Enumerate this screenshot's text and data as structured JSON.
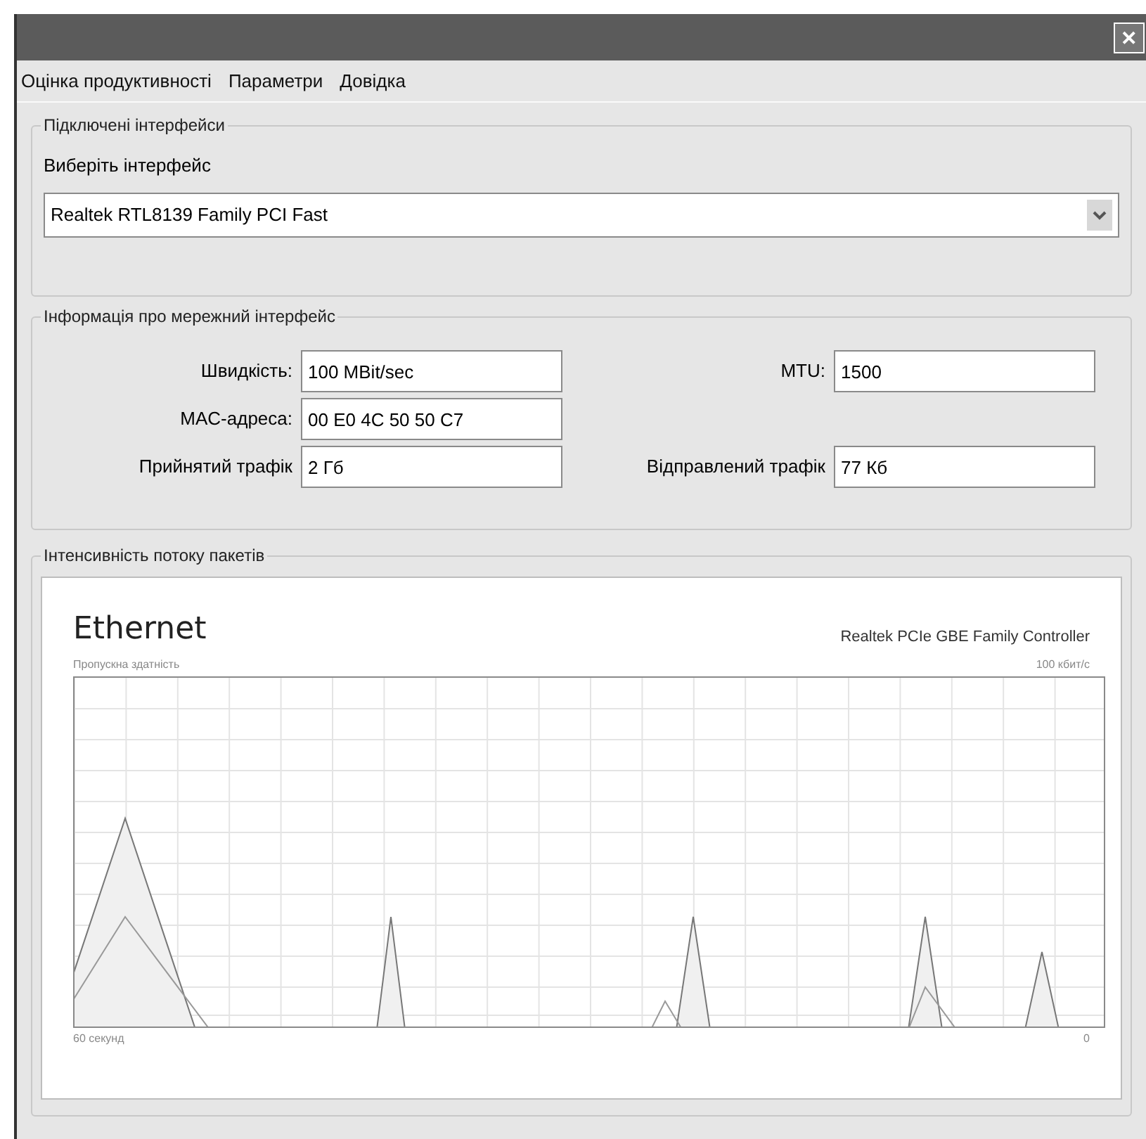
{
  "window": {
    "close": "✕"
  },
  "menu": [
    {
      "label": "Оцінка продуктивності"
    },
    {
      "label": "Параметри"
    },
    {
      "label": "Довідка"
    }
  ],
  "connected": {
    "title": "Підключені інтерфейси",
    "prompt": "Виберіть інтерфейс",
    "value": "Realtek RTL8139 Family PCI Fast"
  },
  "info": {
    "title": "Інформація про мережний інтерфейс",
    "fields": [
      {
        "label": "Швидкість:",
        "value": "100 MBit/sec"
      },
      {
        "label": "MTU:",
        "value": "1500"
      },
      {
        "label": "MAC-адреса:",
        "value": "00 E0 4C 50 50 C7"
      },
      {
        "label": "Прийнятий трафік",
        "value": "2 Гб"
      },
      {
        "label": "Відправлений трафік",
        "value": "77 Кб"
      }
    ]
  },
  "intensity": {
    "title": "Інтенсивність потоку пакетів",
    "graph_title": "Ethernet",
    "adapter": "Realtek PCIe GBE Family Controller",
    "y_caption": "Пропускна здатність",
    "y_max": "100 кбит/с",
    "x_start": "60 секунд",
    "x_end": "0"
  }
}
